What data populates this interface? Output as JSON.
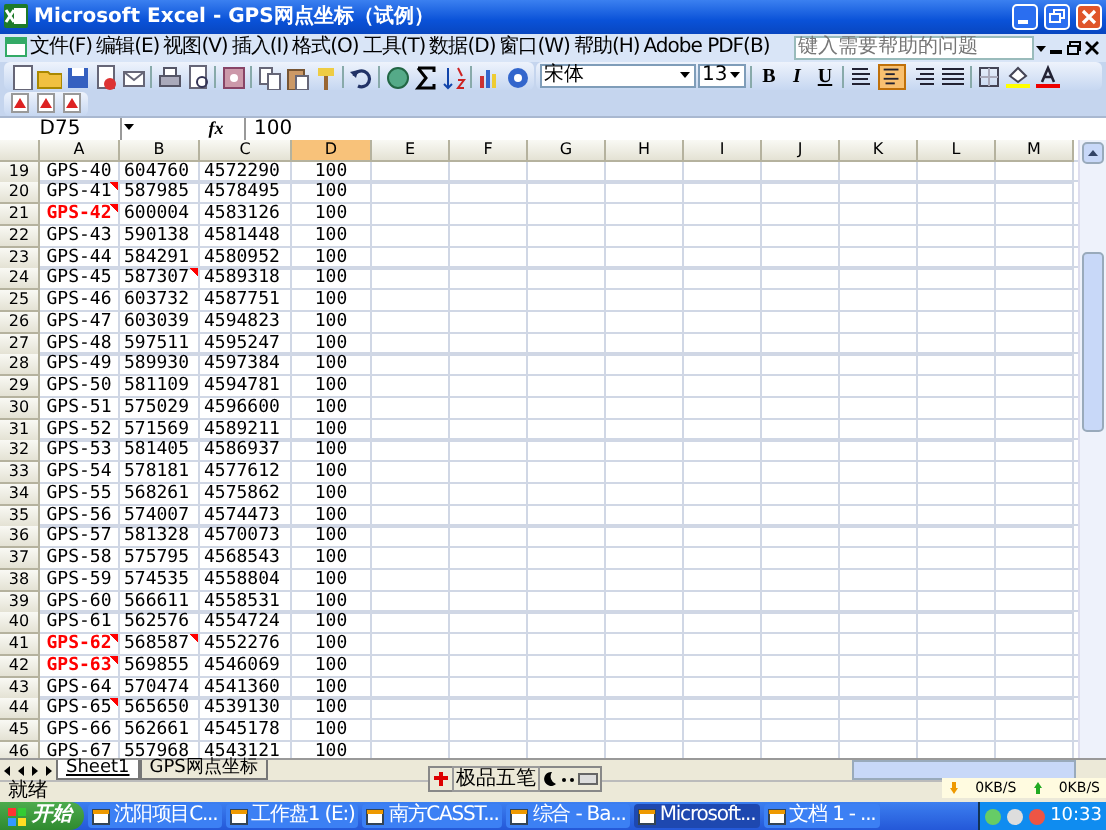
{
  "window": {
    "title": "Microsoft Excel - GPS网点坐标（试例）"
  },
  "menu": [
    "文件(F)",
    "编辑(E)",
    "视图(V)",
    "插入(I)",
    "格式(O)",
    "工具(T)",
    "数据(D)",
    "窗口(W)",
    "帮助(H)",
    "Adobe PDF(B)"
  ],
  "help_box": {
    "placeholder": "键入需要帮助的问题"
  },
  "formatting": {
    "font": "宋体",
    "size": "13",
    "bold": "B",
    "italic": "I",
    "underline": "U",
    "alignments": [
      {
        "selected": false
      },
      {
        "selected": true
      },
      {
        "selected": false
      },
      {
        "selected": false
      }
    ]
  },
  "formula_bar": {
    "name_box": "D75",
    "function_label": "fx",
    "value": "100"
  },
  "columns": [
    {
      "label": "A",
      "selected": false
    },
    {
      "label": "B",
      "selected": false
    },
    {
      "label": "C",
      "selected": false
    },
    {
      "label": "D",
      "selected": true
    },
    {
      "label": "E",
      "selected": false
    },
    {
      "label": "F",
      "selected": false
    },
    {
      "label": "G",
      "selected": false
    },
    {
      "label": "H",
      "selected": false
    },
    {
      "label": "I",
      "selected": false
    },
    {
      "label": "J",
      "selected": false
    },
    {
      "label": "K",
      "selected": false
    },
    {
      "label": "L",
      "selected": false
    },
    {
      "label": "M",
      "selected": false
    }
  ],
  "rows": [
    {
      "n": "19",
      "a": "GPS-40",
      "b": "604760",
      "c": "4572290",
      "d": "100",
      "red": false,
      "note_a": false,
      "note_b": false
    },
    {
      "n": "20",
      "a": "GPS-41",
      "b": "587985",
      "c": "4578495",
      "d": "100",
      "red": false,
      "note_a": true,
      "note_b": false
    },
    {
      "n": "21",
      "a": "GPS-42",
      "b": "600004",
      "c": "4583126",
      "d": "100",
      "red": true,
      "note_a": true,
      "note_b": false
    },
    {
      "n": "22",
      "a": "GPS-43",
      "b": "590138",
      "c": "4581448",
      "d": "100",
      "red": false,
      "note_a": false,
      "note_b": false
    },
    {
      "n": "23",
      "a": "GPS-44",
      "b": "584291",
      "c": "4580952",
      "d": "100",
      "red": false,
      "note_a": false,
      "note_b": false
    },
    {
      "n": "24",
      "a": "GPS-45",
      "b": "587307",
      "c": "4589318",
      "d": "100",
      "red": false,
      "note_a": false,
      "note_b": true
    },
    {
      "n": "25",
      "a": "GPS-46",
      "b": "603732",
      "c": "4587751",
      "d": "100",
      "red": false,
      "note_a": false,
      "note_b": false
    },
    {
      "n": "26",
      "a": "GPS-47",
      "b": "603039",
      "c": "4594823",
      "d": "100",
      "red": false,
      "note_a": false,
      "note_b": false
    },
    {
      "n": "27",
      "a": "GPS-48",
      "b": "597511",
      "c": "4595247",
      "d": "100",
      "red": false,
      "note_a": false,
      "note_b": false
    },
    {
      "n": "28",
      "a": "GPS-49",
      "b": "589930",
      "c": "4597384",
      "d": "100",
      "red": false,
      "note_a": false,
      "note_b": false
    },
    {
      "n": "29",
      "a": "GPS-50",
      "b": "581109",
      "c": "4594781",
      "d": "100",
      "red": false,
      "note_a": false,
      "note_b": false
    },
    {
      "n": "30",
      "a": "GPS-51",
      "b": "575029",
      "c": "4596600",
      "d": "100",
      "red": false,
      "note_a": false,
      "note_b": false
    },
    {
      "n": "31",
      "a": "GPS-52",
      "b": "571569",
      "c": "4589211",
      "d": "100",
      "red": false,
      "note_a": false,
      "note_b": false
    },
    {
      "n": "32",
      "a": "GPS-53",
      "b": "581405",
      "c": "4586937",
      "d": "100",
      "red": false,
      "note_a": false,
      "note_b": false
    },
    {
      "n": "33",
      "a": "GPS-54",
      "b": "578181",
      "c": "4577612",
      "d": "100",
      "red": false,
      "note_a": false,
      "note_b": false
    },
    {
      "n": "34",
      "a": "GPS-55",
      "b": "568261",
      "c": "4575862",
      "d": "100",
      "red": false,
      "note_a": false,
      "note_b": false
    },
    {
      "n": "35",
      "a": "GPS-56",
      "b": "574007",
      "c": "4574473",
      "d": "100",
      "red": false,
      "note_a": false,
      "note_b": false
    },
    {
      "n": "36",
      "a": "GPS-57",
      "b": "581328",
      "c": "4570073",
      "d": "100",
      "red": false,
      "note_a": false,
      "note_b": false
    },
    {
      "n": "37",
      "a": "GPS-58",
      "b": "575795",
      "c": "4568543",
      "d": "100",
      "red": false,
      "note_a": false,
      "note_b": false
    },
    {
      "n": "38",
      "a": "GPS-59",
      "b": "574535",
      "c": "4558804",
      "d": "100",
      "red": false,
      "note_a": false,
      "note_b": false
    },
    {
      "n": "39",
      "a": "GPS-60",
      "b": "566611",
      "c": "4558531",
      "d": "100",
      "red": false,
      "note_a": false,
      "note_b": false
    },
    {
      "n": "40",
      "a": "GPS-61",
      "b": "562576",
      "c": "4554724",
      "d": "100",
      "red": false,
      "note_a": false,
      "note_b": false
    },
    {
      "n": "41",
      "a": "GPS-62",
      "b": "568587",
      "c": "4552276",
      "d": "100",
      "red": true,
      "note_a": true,
      "note_b": true
    },
    {
      "n": "42",
      "a": "GPS-63",
      "b": "569855",
      "c": "4546069",
      "d": "100",
      "red": true,
      "note_a": true,
      "note_b": false
    },
    {
      "n": "43",
      "a": "GPS-64",
      "b": "570474",
      "c": "4541360",
      "d": "100",
      "red": false,
      "note_a": false,
      "note_b": false
    },
    {
      "n": "44",
      "a": "GPS-65",
      "b": "565650",
      "c": "4539130",
      "d": "100",
      "red": false,
      "note_a": true,
      "note_b": false
    },
    {
      "n": "45",
      "a": "GPS-66",
      "b": "562661",
      "c": "4545178",
      "d": "100",
      "red": false,
      "note_a": false,
      "note_b": false
    },
    {
      "n": "46",
      "a": "GPS-67",
      "b": "557968",
      "c": "4543121",
      "d": "100",
      "red": false,
      "note_a": false,
      "note_b": false
    }
  ],
  "sheet_tabs": [
    {
      "label": "Sheet1",
      "selected": true
    },
    {
      "label": "GPS网点坐标",
      "selected": false
    }
  ],
  "status_bar": {
    "text": "就绪"
  },
  "ime_bar": {
    "label": "极品五笔"
  },
  "network": {
    "up": "0KB/S",
    "down": "0KB/S"
  },
  "taskbar": {
    "start": "开始",
    "items": [
      {
        "label": "沈阳项目C...",
        "selected": false
      },
      {
        "label": "工作盘1 (E:)",
        "selected": false
      },
      {
        "label": "南方CASST...",
        "selected": false
      },
      {
        "label": "综合 - Ba...",
        "selected": false
      },
      {
        "label": "Microsoft...",
        "selected": true
      },
      {
        "label": "文档 1 - ...",
        "selected": false
      }
    ],
    "clock": "10:33"
  }
}
